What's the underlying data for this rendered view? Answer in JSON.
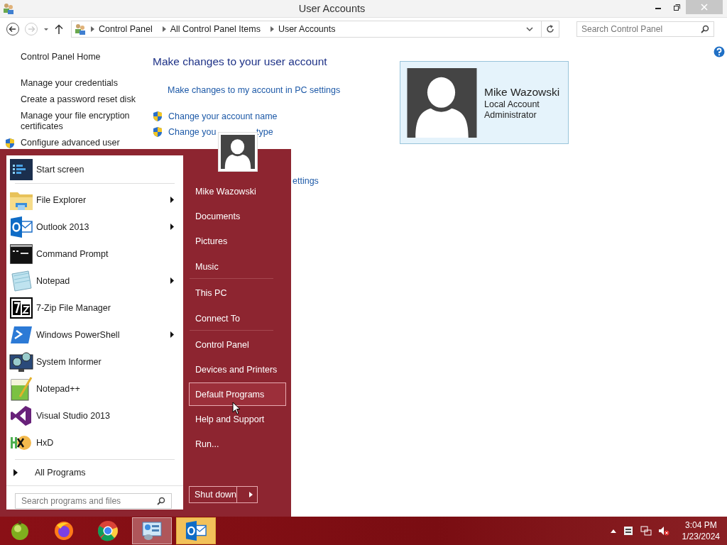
{
  "window": {
    "title": "User Accounts"
  },
  "address_bar": {
    "breadcrumbs": [
      "Control Panel",
      "All Control Panel Items",
      "User Accounts"
    ]
  },
  "search": {
    "placeholder": "Search Control Panel"
  },
  "sidebar": {
    "items": [
      {
        "label": "Control Panel Home",
        "kind": "home"
      },
      {
        "label": "Manage your credentials",
        "kind": "plain"
      },
      {
        "label": "Create a password reset disk",
        "kind": "plain"
      },
      {
        "label": "Manage your file encryption certificates",
        "kind": "plain"
      },
      {
        "label": "Configure advanced user",
        "kind": "shield"
      }
    ]
  },
  "content": {
    "heading": "Make changes to your user account",
    "links": [
      {
        "label": "Make changes to my account in PC settings",
        "kind": "plain"
      },
      {
        "label": "Change your account name",
        "kind": "shield"
      },
      {
        "label": "Change you",
        "label_after": "type",
        "kind": "shield"
      }
    ],
    "cut_text": "ettings"
  },
  "account": {
    "name": "Mike Wazowski",
    "type": "Local Account",
    "role": "Administrator"
  },
  "start_menu": {
    "programs": [
      {
        "label": "Start screen",
        "submenu": false
      },
      {
        "label": "File Explorer",
        "submenu": true
      },
      {
        "label": "Outlook 2013",
        "submenu": true
      },
      {
        "label": "Command Prompt",
        "submenu": false
      },
      {
        "label": "Notepad",
        "submenu": true
      },
      {
        "label": "7-Zip File Manager",
        "submenu": false
      },
      {
        "label": "Windows PowerShell",
        "submenu": true
      },
      {
        "label": "System Informer",
        "submenu": false
      },
      {
        "label": "Notepad++",
        "submenu": false
      },
      {
        "label": "Visual Studio 2013",
        "submenu": false
      },
      {
        "label": "HxD",
        "submenu": false
      }
    ],
    "all_programs": "All Programs",
    "search": {
      "placeholder": "Search programs and files"
    },
    "places": [
      {
        "label": "Mike Wazowski",
        "selected": false,
        "separator_after": false
      },
      {
        "label": "Documents",
        "selected": false,
        "separator_after": false
      },
      {
        "label": "Pictures",
        "selected": false,
        "separator_after": false
      },
      {
        "label": "Music",
        "selected": false,
        "separator_after": true
      },
      {
        "label": "This PC",
        "selected": false,
        "separator_after": false
      },
      {
        "label": "Connect To",
        "selected": false,
        "separator_after": true
      },
      {
        "label": "Control Panel",
        "selected": false,
        "separator_after": false
      },
      {
        "label": "Devices and Printers",
        "selected": false,
        "separator_after": false
      },
      {
        "label": "Default Programs",
        "selected": true,
        "separator_after": false
      },
      {
        "label": "Help and Support",
        "selected": false,
        "separator_after": false
      },
      {
        "label": "Run...",
        "selected": false,
        "separator_after": false
      }
    ],
    "shutdown": "Shut down"
  },
  "taskbar": {
    "apps": [
      {
        "active": false,
        "flashing": false
      },
      {
        "active": false,
        "flashing": false
      },
      {
        "active": false,
        "flashing": false
      },
      {
        "active": true,
        "flashing": false
      },
      {
        "active": false,
        "flashing": true
      }
    ],
    "time": "3:04 PM",
    "date": "1/23/2024"
  }
}
